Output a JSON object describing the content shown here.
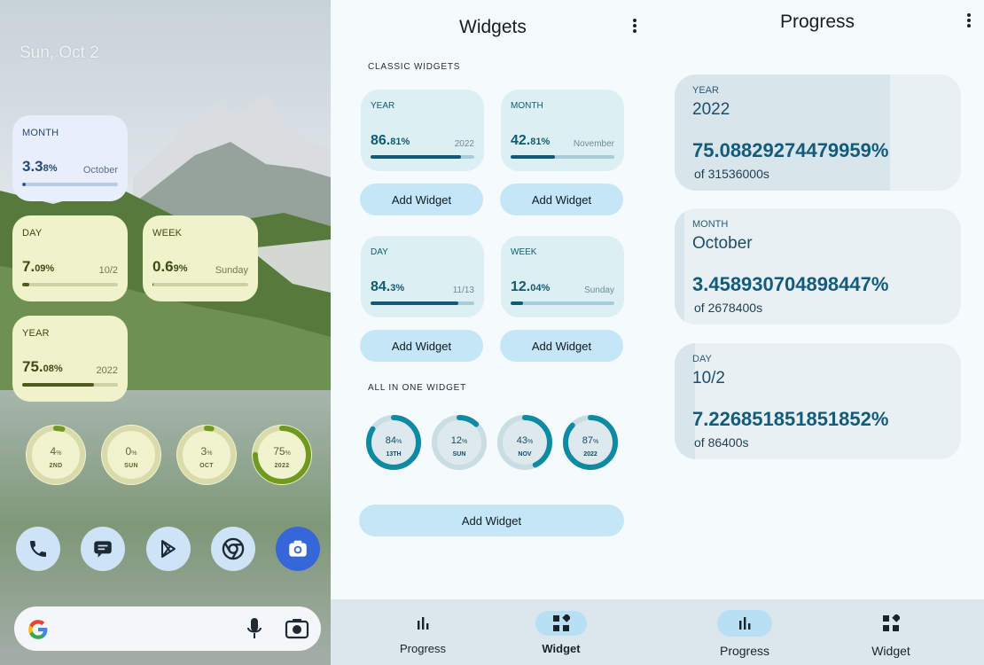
{
  "home": {
    "date": "Sun, Oct 2",
    "widgets": [
      {
        "key": "month",
        "label": "MONTH",
        "big": "3.3",
        "small": "8%",
        "sub": "October",
        "progress": 0.035
      },
      {
        "key": "day",
        "label": "DAY",
        "big": "7.",
        "small": "09%",
        "sub": "10/2",
        "progress": 0.07
      },
      {
        "key": "week",
        "label": "WEEK",
        "big": "0.6",
        "small": "9%",
        "sub": "Sunday",
        "progress": 0.007
      },
      {
        "key": "year",
        "label": "YEAR",
        "big": "75.",
        "small": "08%",
        "sub": "2022",
        "progress": 0.75
      }
    ],
    "circles": [
      {
        "value": "4",
        "unit": "%",
        "label": "2ND",
        "progress": 0.04
      },
      {
        "value": "0",
        "unit": "%",
        "label": "SUN",
        "progress": 0.0
      },
      {
        "value": "3",
        "unit": "%",
        "label": "OCT",
        "progress": 0.03
      },
      {
        "value": "75",
        "unit": "%",
        "label": "2022",
        "progress": 0.75
      }
    ],
    "dock": [
      "phone-icon",
      "messages-icon",
      "play-store-icon",
      "chrome-icon",
      "camera-icon"
    ],
    "accent": "#4d5b1f"
  },
  "widgets_screen": {
    "title": "Widgets",
    "classic_header": "CLASSIC WIDGETS",
    "classic": [
      {
        "key": "year",
        "label": "YEAR",
        "big": "86.",
        "small": "81%",
        "sub": "2022",
        "progress": 0.8681
      },
      {
        "key": "month",
        "label": "MONTH",
        "big": "42.",
        "small": "81%",
        "sub": "November",
        "progress": 0.4281
      },
      {
        "key": "day",
        "label": "DAY",
        "big": "84.",
        "small": "3%",
        "sub": "11/13",
        "progress": 0.843
      },
      {
        "key": "week",
        "label": "WEEK",
        "big": "12.",
        "small": "04%",
        "sub": "Sunday",
        "progress": 0.1204
      }
    ],
    "add_widget_label": "Add Widget",
    "all_in_one_header": "ALL IN ONE WIDGET",
    "circles": [
      {
        "value": "84",
        "unit": "%",
        "label": "13TH",
        "progress": 0.84
      },
      {
        "value": "12",
        "unit": "%",
        "label": "SUN",
        "progress": 0.12
      },
      {
        "value": "43",
        "unit": "%",
        "label": "NOV",
        "progress": 0.43
      },
      {
        "value": "87",
        "unit": "%",
        "label": "2022",
        "progress": 0.87
      }
    ],
    "accent": "#0f8aa3"
  },
  "progress_screen": {
    "title": "Progress",
    "cards": [
      {
        "label": "YEAR",
        "name": "2022",
        "value": "75.08829274479959%",
        "of": "of 31536000s",
        "progress": 0.7509
      },
      {
        "label": "MONTH",
        "name": "October",
        "value": "3.458930704898447%",
        "of": "of 2678400s",
        "progress": 0.0346
      },
      {
        "label": "DAY",
        "name": "10/2",
        "value": "7.226851851851852%",
        "of": "of 86400s",
        "progress": 0.0723
      }
    ]
  },
  "nav": {
    "progress": "Progress",
    "widget": "Widget"
  }
}
